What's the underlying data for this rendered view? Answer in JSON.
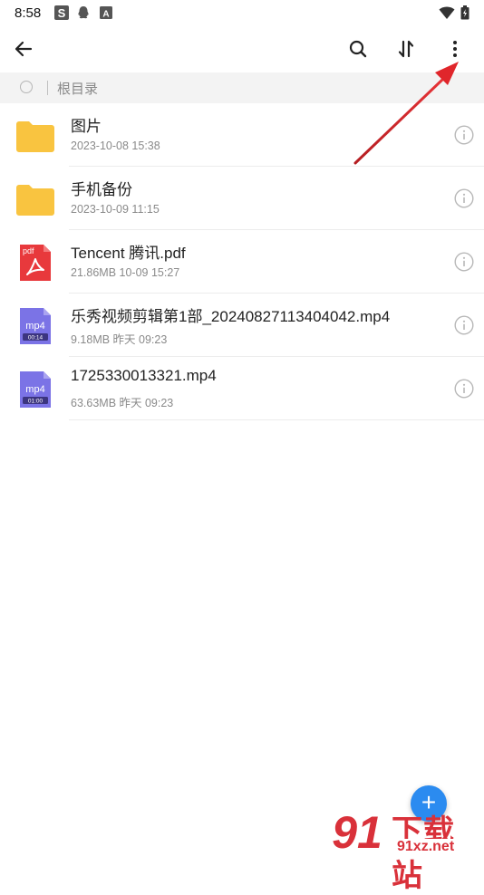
{
  "status_bar": {
    "time": "8:58",
    "left_icons": [
      "s-app-icon",
      "qq-icon",
      "a-app-icon"
    ],
    "right_icons": [
      "wifi-icon",
      "battery-icon"
    ]
  },
  "toolbar": {
    "icons": [
      "back-arrow-icon",
      "search-icon",
      "sort-icon",
      "more-vertical-icon"
    ]
  },
  "breadcrumb": {
    "label": "根目录"
  },
  "files": [
    {
      "name": "图片",
      "meta": "2023-10-08 15:38",
      "icon": "folder-icon"
    },
    {
      "name": "手机备份",
      "meta": "2023-10-09 11:15",
      "icon": "folder-icon"
    },
    {
      "name": "Tencent 腾讯.pdf",
      "meta": "21.86MB   10-09 15:27",
      "icon": "pdf-file-icon",
      "badge": "pdf"
    },
    {
      "name": "乐秀视频剪辑第1部_20240827113404042.mp4",
      "meta": "9.18MB   昨天 09:23",
      "icon": "video-file-icon",
      "badge": "mp4",
      "duration": "00:14"
    },
    {
      "name": "1725330013321.mp4",
      "meta": "63.63MB   昨天 09:23",
      "icon": "video-file-icon",
      "badge": "mp4",
      "duration": "01:00"
    }
  ],
  "fab": {
    "label": "+"
  },
  "watermark": {
    "brand": "下载站",
    "url": "91xz.net"
  },
  "colors": {
    "folder": "#f9c440",
    "pdf": "#e8393c",
    "video": "#7b73e6",
    "fab": "#2b8bf0",
    "annotation_arrow": "#e0262b"
  }
}
